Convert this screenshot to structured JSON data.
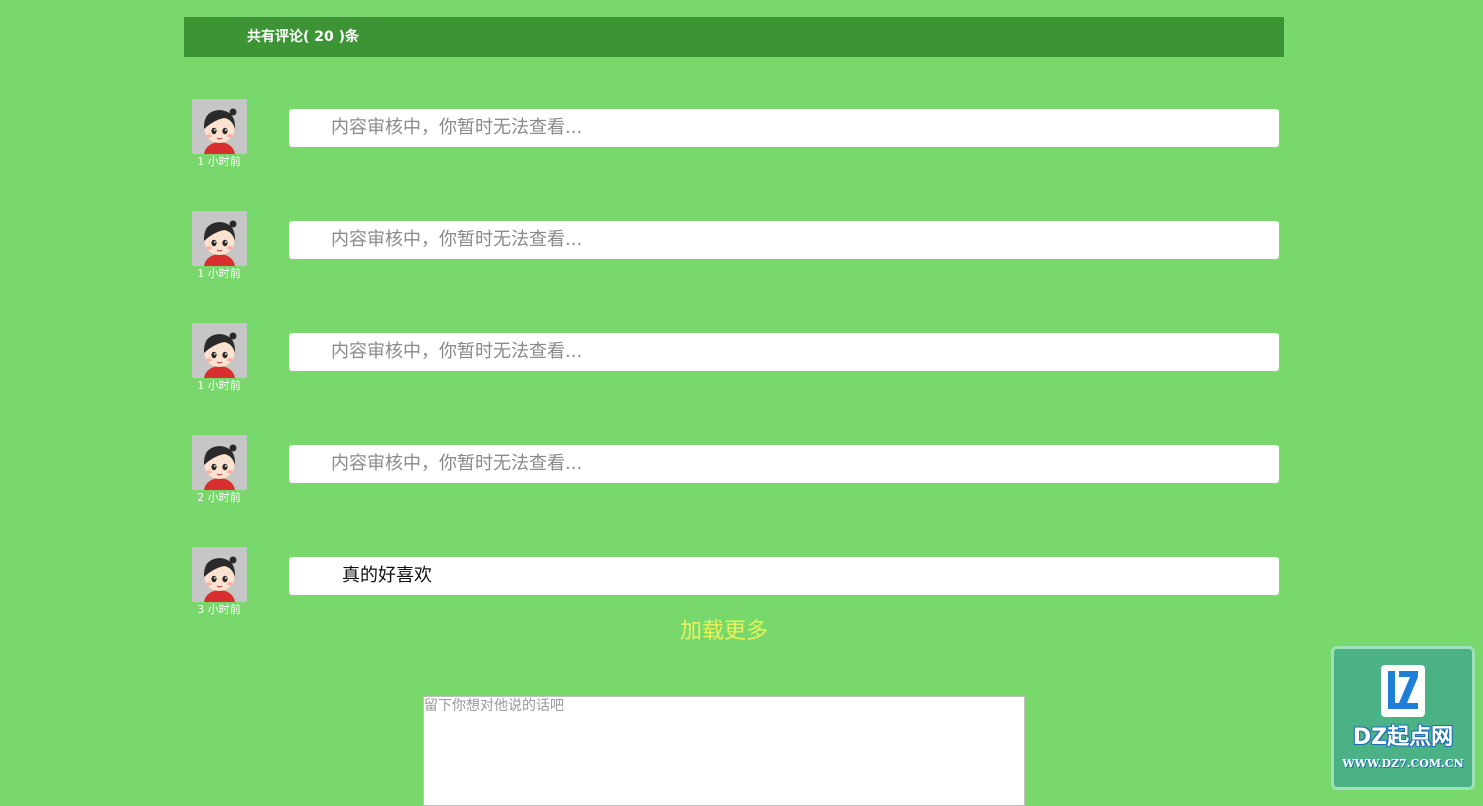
{
  "header": {
    "title": "共有评论( 20 )条"
  },
  "comments": [
    {
      "time": "1 小时前",
      "content": "内容审核中，你暂时无法查看...",
      "status": "pending"
    },
    {
      "time": "1 小时前",
      "content": "内容审核中，你暂时无法查看...",
      "status": "pending"
    },
    {
      "time": "1 小时前",
      "content": "内容审核中，你暂时无法查看...",
      "status": "pending"
    },
    {
      "time": "2 小时前",
      "content": "内容审核中，你暂时无法查看...",
      "status": "pending"
    },
    {
      "time": "3 小时前",
      "content": "真的好喜欢",
      "status": "published"
    }
  ],
  "load_more": {
    "label": "加载更多"
  },
  "message_input": {
    "placeholder": "留下你想对他说的话吧",
    "value": ""
  },
  "watermark": {
    "logo_icon": "dz-logo-icon",
    "name": "DZ起点网",
    "url": "WWW.DZ7.COM.CN"
  },
  "colors": {
    "page_background": "#78d86b",
    "header_bar": "#3d9434",
    "load_more_text": "#e8f25a",
    "pending_text": "#8a8a8a",
    "published_text": "#111111",
    "watermark_background": "#4bb285"
  }
}
